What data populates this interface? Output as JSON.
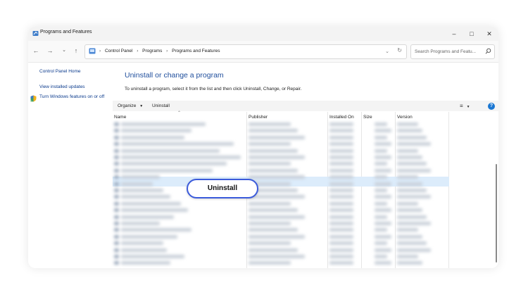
{
  "window": {
    "title": "Programs and Features"
  },
  "address": {
    "crumbs": [
      "Control Panel",
      "Programs",
      "Programs and Features"
    ]
  },
  "search": {
    "placeholder": "Search Programs and Featu..."
  },
  "sidebar": {
    "home": "Control Panel Home",
    "updates": "View installed updates",
    "features": "Turn Windows features on or off"
  },
  "main": {
    "heading": "Uninstall or change a program",
    "description": "To uninstall a program, select it from the list and then click Uninstall, Change, or Repair."
  },
  "toolbar": {
    "organize": "Organize",
    "uninstall": "Uninstall"
  },
  "columns": [
    "Name",
    "Publisher",
    "Installed On",
    "Size",
    "Version"
  ],
  "callout": {
    "label": "Uninstall"
  },
  "icons": {
    "app": "control-panel-icon",
    "back": "back-arrow-icon",
    "forward": "forward-arrow-icon",
    "recent": "chevron-down-icon",
    "up": "up-arrow-icon",
    "refresh": "refresh-icon",
    "search": "search-icon",
    "shield": "shield-icon",
    "views": "view-options-icon",
    "help": "help-icon"
  },
  "colors": {
    "accent": "#1f4e9c",
    "callout_border": "#3b5bdb",
    "selected_row": "#dcecfb",
    "help": "#1976d2"
  }
}
